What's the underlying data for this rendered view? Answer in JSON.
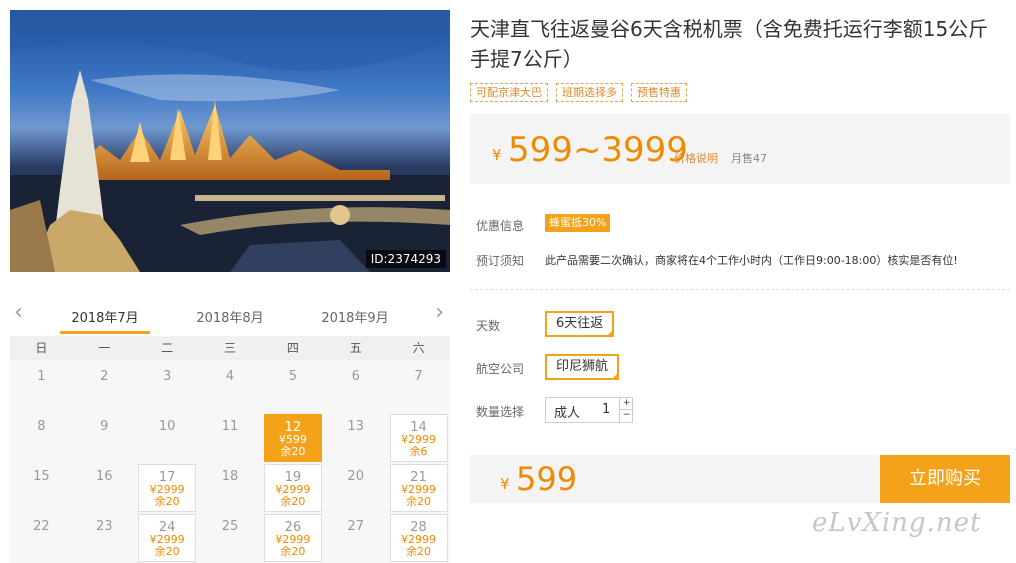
{
  "product": {
    "title": "天津直飞往返曼谷6天含税机票（含免费托运行李额15公斤手提7公斤）",
    "tags": [
      "可配京津大巴",
      "班期选择多",
      "预售特惠"
    ],
    "photo_id": "ID:2374293"
  },
  "price": {
    "currency": "¥",
    "range": "599~3999",
    "explain_label": "价格说明",
    "monthly_sales": "月售47"
  },
  "info": {
    "discount_label": "优惠信息",
    "discount_badge": "蜂蜜抵30%",
    "notice_label": "预订须知",
    "notice_text": "此产品需要二次确认，商家将在4个工作小时内（工作日9:00-18:00）核实是否有位!"
  },
  "options": {
    "days_label": "天数",
    "days_value": "6天往返",
    "airline_label": "航空公司",
    "airline_value": "印尼狮航",
    "qty_label": "数量选择",
    "qty_type": "成人",
    "qty_value": "1",
    "plus": "+",
    "minus": "−"
  },
  "checkout": {
    "currency": "¥",
    "price": "599",
    "buy_label": "立即购买"
  },
  "calendar": {
    "prev": "‹",
    "next": "›",
    "months": [
      "2018年7月",
      "2018年8月",
      "2018年9月"
    ],
    "active_month": 0,
    "weekdays": [
      "日",
      "一",
      "二",
      "三",
      "四",
      "五",
      "六"
    ],
    "days": [
      {
        "d": "1"
      },
      {
        "d": "2"
      },
      {
        "d": "3"
      },
      {
        "d": "4"
      },
      {
        "d": "5"
      },
      {
        "d": "6"
      },
      {
        "d": "7"
      },
      {
        "d": "8"
      },
      {
        "d": "9"
      },
      {
        "d": "10"
      },
      {
        "d": "11"
      },
      {
        "d": "12",
        "p": "¥599",
        "s": "余20",
        "selected": true
      },
      {
        "d": "13"
      },
      {
        "d": "14",
        "p": "¥2999",
        "s": "余6"
      },
      {
        "d": "15"
      },
      {
        "d": "16"
      },
      {
        "d": "17",
        "p": "¥2999",
        "s": "余20"
      },
      {
        "d": "18"
      },
      {
        "d": "19",
        "p": "¥2999",
        "s": "余20"
      },
      {
        "d": "20"
      },
      {
        "d": "21",
        "p": "¥2999",
        "s": "余20"
      },
      {
        "d": "22"
      },
      {
        "d": "23"
      },
      {
        "d": "24",
        "p": "¥2999",
        "s": "余20"
      },
      {
        "d": "25"
      },
      {
        "d": "26",
        "p": "¥2999",
        "s": "余20"
      },
      {
        "d": "27"
      },
      {
        "d": "28",
        "p": "¥2999",
        "s": "余20"
      }
    ]
  },
  "watermark": "eLvXing.net",
  "colors": {
    "accent": "#f5a21b",
    "price": "#f08a00"
  }
}
